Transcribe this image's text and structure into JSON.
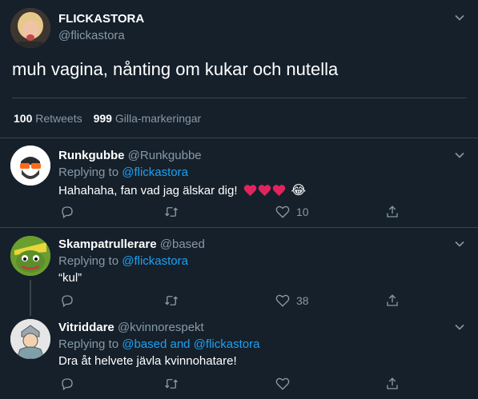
{
  "main_tweet": {
    "display_name": "FLICKASTORA",
    "handle": "@flickastora",
    "text": "muh vagina, nånting om kukar och nutella",
    "retweets_count": "100",
    "retweets_label": "Retweets",
    "likes_count": "999",
    "likes_label": "Gilla-markeringar"
  },
  "replies": [
    {
      "display_name": "Runkgubbe",
      "handle": "@Runkgubbe",
      "replying_prefix": "Replying to",
      "replying_to": "@flickastora",
      "text": "Hahahaha, fan vad jag älskar dig!",
      "emoji_suffix": "😂",
      "like_count": "10"
    },
    {
      "display_name": "Skampatrullerare",
      "handle": "@based",
      "replying_prefix": "Replying to",
      "replying_to": "@flickastora",
      "text": "“kul”",
      "like_count": "38"
    },
    {
      "display_name": "Vitriddare",
      "handle": "@kvinnorespekt",
      "replying_prefix": "Replying to",
      "replying_to": "@based and @flickastora",
      "text": "Dra åt helvete jävla kvinnohatare!",
      "like_count": ""
    }
  ],
  "colors": {
    "background": "#15202b",
    "divider": "#38444d",
    "muted": "#8899a6",
    "link": "#1da1f2",
    "heart": "#e0245e"
  },
  "icons": [
    "chevron-down-icon",
    "reply-icon",
    "retweet-icon",
    "like-icon",
    "share-icon",
    "heart-icon",
    "laughing-emoji-icon"
  ]
}
